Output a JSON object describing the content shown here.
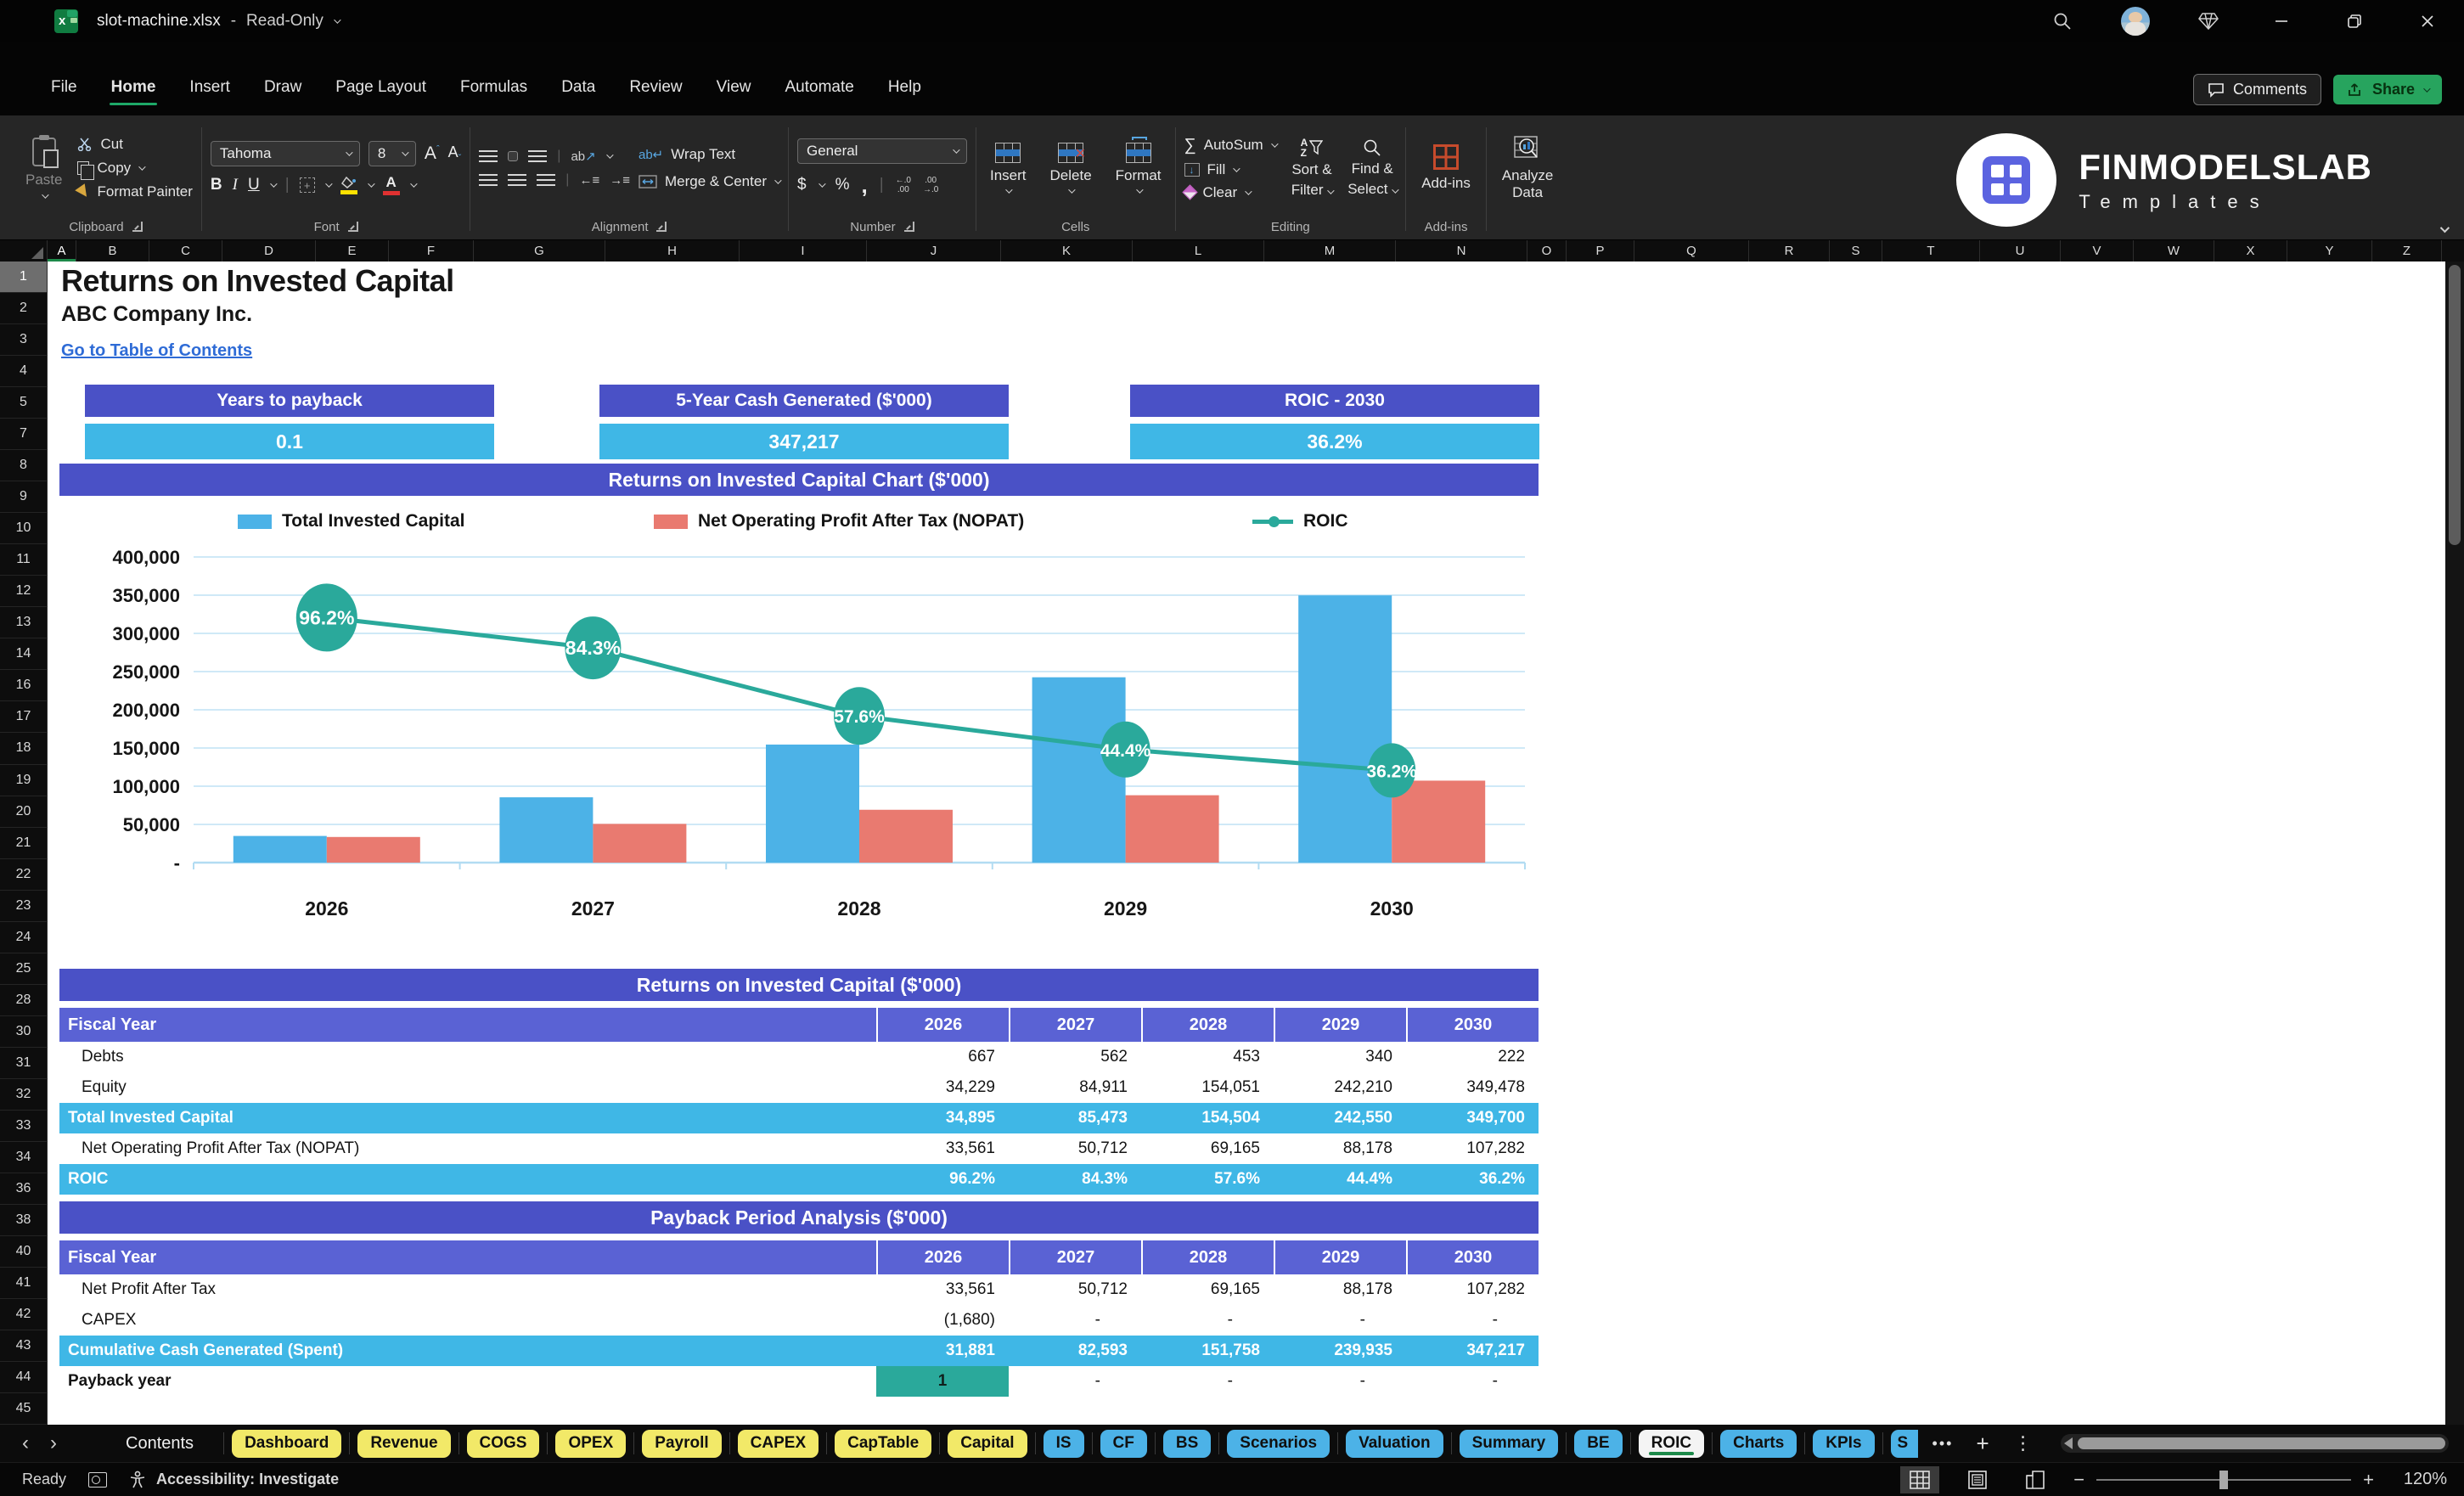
{
  "window": {
    "title": "slot-machine.xlsx",
    "separator": "-",
    "mode": "Read-Only"
  },
  "menu": {
    "tabs": [
      "File",
      "Home",
      "Insert",
      "Draw",
      "Page Layout",
      "Formulas",
      "Data",
      "Review",
      "View",
      "Automate",
      "Help"
    ],
    "active": "Home",
    "comments_label": "Comments",
    "share_label": "Share"
  },
  "ribbon": {
    "clipboard": {
      "label": "Clipboard",
      "paste": "Paste",
      "cut": "Cut",
      "copy": "Copy",
      "format_painter": "Format Painter"
    },
    "font": {
      "label": "Font",
      "family": "Tahoma",
      "size": "8",
      "bold": "B",
      "italic": "I",
      "underline": "U"
    },
    "alignment": {
      "label": "Alignment",
      "wrap": "Wrap Text",
      "merge": "Merge & Center",
      "orientation": "ab"
    },
    "number": {
      "label": "Number",
      "format": "General",
      "currency": "$",
      "percent": "%",
      "comma": ","
    },
    "cells": {
      "label": "Cells",
      "insert": "Insert",
      "delete": "Delete",
      "format": "Format"
    },
    "editing": {
      "label": "Editing",
      "autosum": "AutoSum",
      "fill": "Fill",
      "clear": "Clear",
      "sort1": "Sort &",
      "sort2": "Filter",
      "find1": "Find &",
      "find2": "Select"
    },
    "addins": {
      "label": "Add-ins",
      "addins": "Add-ins",
      "analyze1": "Analyze",
      "analyze2": "Data"
    },
    "brand": {
      "name": "FINMODELSLAB",
      "sub": "Templates"
    }
  },
  "sheet": {
    "columns": [
      "A",
      "B",
      "C",
      "D",
      "E",
      "F",
      "G",
      "H",
      "I",
      "J",
      "K",
      "L",
      "M",
      "N",
      "O",
      "P",
      "Q",
      "R",
      "S",
      "T",
      "U",
      "V",
      "W",
      "X",
      "Y",
      "Z"
    ],
    "rows": [
      1,
      2,
      3,
      4,
      5,
      7,
      8,
      9,
      10,
      11,
      12,
      13,
      14,
      16,
      17,
      18,
      19,
      20,
      21,
      22,
      23,
      24,
      25,
      28,
      30,
      31,
      32,
      33,
      34,
      36,
      38,
      40,
      41,
      42,
      43,
      44,
      45
    ],
    "active_row": 1,
    "active_column": "A"
  },
  "page": {
    "title": "Returns on Invested Capital",
    "company": "ABC Company Inc.",
    "link": "Go to Table of Contents"
  },
  "kpis": [
    {
      "label": "Years to payback",
      "value": "0.1"
    },
    {
      "label": "5-Year Cash Generated ($'000)",
      "value": "347,217"
    },
    {
      "label": "ROIC - 2030",
      "value": "36.2%"
    }
  ],
  "chart_data": {
    "type": "bar+line",
    "title": "Returns on Invested Capital Chart ($'000)",
    "categories": [
      "2026",
      "2027",
      "2028",
      "2029",
      "2030"
    ],
    "series": [
      {
        "name": "Total Invested Capital",
        "type": "bar",
        "color": "#4cb2e7",
        "values": [
          34895,
          85473,
          154504,
          242550,
          349700
        ]
      },
      {
        "name": "Net Operating Profit After Tax (NOPAT)",
        "type": "bar",
        "color": "#e97a70",
        "values": [
          33561,
          50712,
          69165,
          88178,
          107282
        ]
      },
      {
        "name": "ROIC",
        "type": "line",
        "color": "#2aa99b",
        "values_pct": [
          96.2,
          84.3,
          57.6,
          44.4,
          36.2
        ],
        "labels": [
          "96.2%",
          "84.3%",
          "57.6%",
          "44.4%",
          "36.2%"
        ]
      }
    ],
    "y_ticks": [
      "400,000",
      "350,000",
      "300,000",
      "250,000",
      "200,000",
      "150,000",
      "100,000",
      "50,000",
      "-"
    ],
    "ylim": [
      0,
      400000
    ],
    "secondary_ylim": [
      0,
      120
    ],
    "grid": true,
    "legend_position": "top"
  },
  "tables": [
    {
      "title": "Returns on Invested Capital ($'000)",
      "header": [
        "Fiscal Year",
        "2026",
        "2027",
        "2028",
        "2029",
        "2030"
      ],
      "rows": [
        {
          "label": "Debts",
          "values": [
            "667",
            "562",
            "453",
            "340",
            "222"
          ],
          "style": "plain"
        },
        {
          "label": "Equity",
          "values": [
            "34,229",
            "84,911",
            "154,051",
            "242,210",
            "349,478"
          ],
          "style": "plain"
        },
        {
          "label": "Total Invested Capital",
          "values": [
            "34,895",
            "85,473",
            "154,504",
            "242,550",
            "349,700"
          ],
          "style": "highlight"
        },
        {
          "label": "Net Operating Profit After Tax (NOPAT)",
          "values": [
            "33,561",
            "50,712",
            "69,165",
            "88,178",
            "107,282"
          ],
          "style": "plain"
        },
        {
          "label": "ROIC",
          "values": [
            "96.2%",
            "84.3%",
            "57.6%",
            "44.4%",
            "36.2%"
          ],
          "style": "highlight"
        }
      ]
    },
    {
      "title": "Payback Period Analysis ($'000)",
      "header": [
        "Fiscal Year",
        "2026",
        "2027",
        "2028",
        "2029",
        "2030"
      ],
      "rows": [
        {
          "label": "Net Profit After Tax",
          "values": [
            "33,561",
            "50,712",
            "69,165",
            "88,178",
            "107,282"
          ],
          "style": "plain"
        },
        {
          "label": "CAPEX",
          "values": [
            "(1,680)",
            "-",
            "-",
            "-",
            "-"
          ],
          "style": "plain"
        },
        {
          "label": "Cumulative Cash Generated (Spent)",
          "values": [
            "31,881",
            "82,593",
            "151,758",
            "239,935",
            "347,217"
          ],
          "style": "highlight"
        },
        {
          "label": "Payback year",
          "values": [
            "1",
            "-",
            "-",
            "-",
            "-"
          ],
          "style": "payback"
        }
      ]
    }
  ],
  "sheet_tabs": {
    "prev": "‹",
    "next": "›",
    "items": [
      {
        "label": "Contents",
        "style": "plain"
      },
      {
        "label": "Dashboard",
        "style": "yellow"
      },
      {
        "label": "Revenue",
        "style": "yellow"
      },
      {
        "label": "COGS",
        "style": "yellow"
      },
      {
        "label": "OPEX",
        "style": "yellow"
      },
      {
        "label": "Payroll",
        "style": "yellow"
      },
      {
        "label": "CAPEX",
        "style": "yellow"
      },
      {
        "label": "CapTable",
        "style": "yellow"
      },
      {
        "label": "Capital",
        "style": "yellow"
      },
      {
        "label": "IS",
        "style": "blue"
      },
      {
        "label": "CF",
        "style": "blue"
      },
      {
        "label": "BS",
        "style": "blue"
      },
      {
        "label": "Scenarios",
        "style": "blue"
      },
      {
        "label": "Valuation",
        "style": "blue"
      },
      {
        "label": "Summary",
        "style": "blue"
      },
      {
        "label": "BE",
        "style": "blue"
      },
      {
        "label": "ROIC",
        "style": "active"
      },
      {
        "label": "Charts",
        "style": "blue"
      },
      {
        "label": "KPIs",
        "style": "blue"
      },
      {
        "label": "S",
        "style": "blue-partial"
      }
    ],
    "overflow": "•••",
    "add": "+",
    "menu": "⋮"
  },
  "status": {
    "ready": "Ready",
    "accessibility": "Accessibility: Investigate",
    "zoom_minus": "−",
    "zoom_plus": "+",
    "zoom": "120%"
  },
  "colors": {
    "banner_purple": "#4a51c6",
    "header_purple": "#5a62d4",
    "light_blue": "#3fb7e6",
    "bar_blue": "#4cb2e7",
    "bar_salmon": "#e97a70",
    "teal": "#2aa99b",
    "tab_yellow": "#f2e968",
    "tab_blue": "#4cb2e7",
    "share_green": "#27a45e",
    "link_blue": "#2e6bd6",
    "grid_line": "#b2dcf2"
  }
}
